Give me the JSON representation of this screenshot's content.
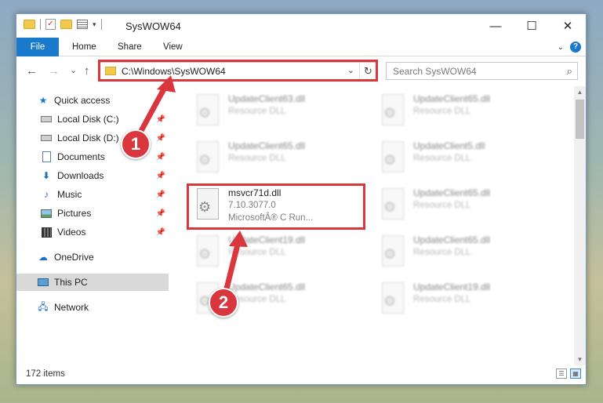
{
  "window": {
    "title": "SysWOW64",
    "min": "—",
    "max": "☐",
    "close": "✕"
  },
  "ribbon": {
    "tabs": [
      "File",
      "Home",
      "Share",
      "View"
    ]
  },
  "nav": {
    "back": "←",
    "forward": "→",
    "recent": "⌄",
    "up": "↑",
    "address": "C:\\Windows\\SysWOW64",
    "search_placeholder": "Search SysWOW64"
  },
  "sidebar": {
    "items": [
      {
        "label": "Quick access",
        "icon": "star-icon"
      },
      {
        "label": "Local Disk (C:)",
        "icon": "drive-icon",
        "pinned": true
      },
      {
        "label": "Local Disk (D:)",
        "icon": "drive-icon",
        "pinned": true
      },
      {
        "label": "Documents",
        "icon": "documents-icon",
        "pinned": true
      },
      {
        "label": "Downloads",
        "icon": "download-icon",
        "pinned": true
      },
      {
        "label": "Music",
        "icon": "music-icon",
        "pinned": true
      },
      {
        "label": "Pictures",
        "icon": "pictures-icon",
        "pinned": true
      },
      {
        "label": "Videos",
        "icon": "videos-icon",
        "pinned": true
      },
      {
        "label": "OneDrive",
        "icon": "cloud-icon"
      },
      {
        "label": "This PC",
        "icon": "computer-icon",
        "selected": true
      },
      {
        "label": "Network",
        "icon": "network-icon"
      }
    ]
  },
  "files": [
    {
      "name": "UpdateClient63.dll",
      "l2": "Resource DLL",
      "l3": "",
      "blurred": true
    },
    {
      "name": "UpdateClient65.dll",
      "l2": "Resource DLL",
      "l3": "",
      "blurred": true
    },
    {
      "name": "UpdateClient65.dll",
      "l2": "Resource DLL",
      "l3": "",
      "blurred": true
    },
    {
      "name": "UpdateClient5.dll",
      "l2": "Resource DLL",
      "l3": "",
      "blurred": true
    },
    {
      "name": "msvcr71d.dll",
      "l2": "7.10.3077.0",
      "l3": "MicrosoftÂ® C Run...",
      "blurred": false
    },
    {
      "name": "UpdateClient65.dll",
      "l2": "Resource DLL",
      "l3": "",
      "blurred": true
    },
    {
      "name": "UpdateClient19.dll",
      "l2": "Resource DLL",
      "l3": "",
      "blurred": true
    },
    {
      "name": "UpdateClient65.dll",
      "l2": "Resource DLL",
      "l3": "",
      "blurred": true
    },
    {
      "name": "UpdateClient65.dll",
      "l2": "Resource DLL",
      "l3": "",
      "blurred": true
    },
    {
      "name": "UpdateClient19.dll",
      "l2": "Resource DLL",
      "l3": "",
      "blurred": true
    }
  ],
  "status": {
    "count": "172 items"
  },
  "markers": [
    "1",
    "2"
  ],
  "colors": {
    "accent": "#1979ca",
    "highlight": "#d9363e"
  }
}
